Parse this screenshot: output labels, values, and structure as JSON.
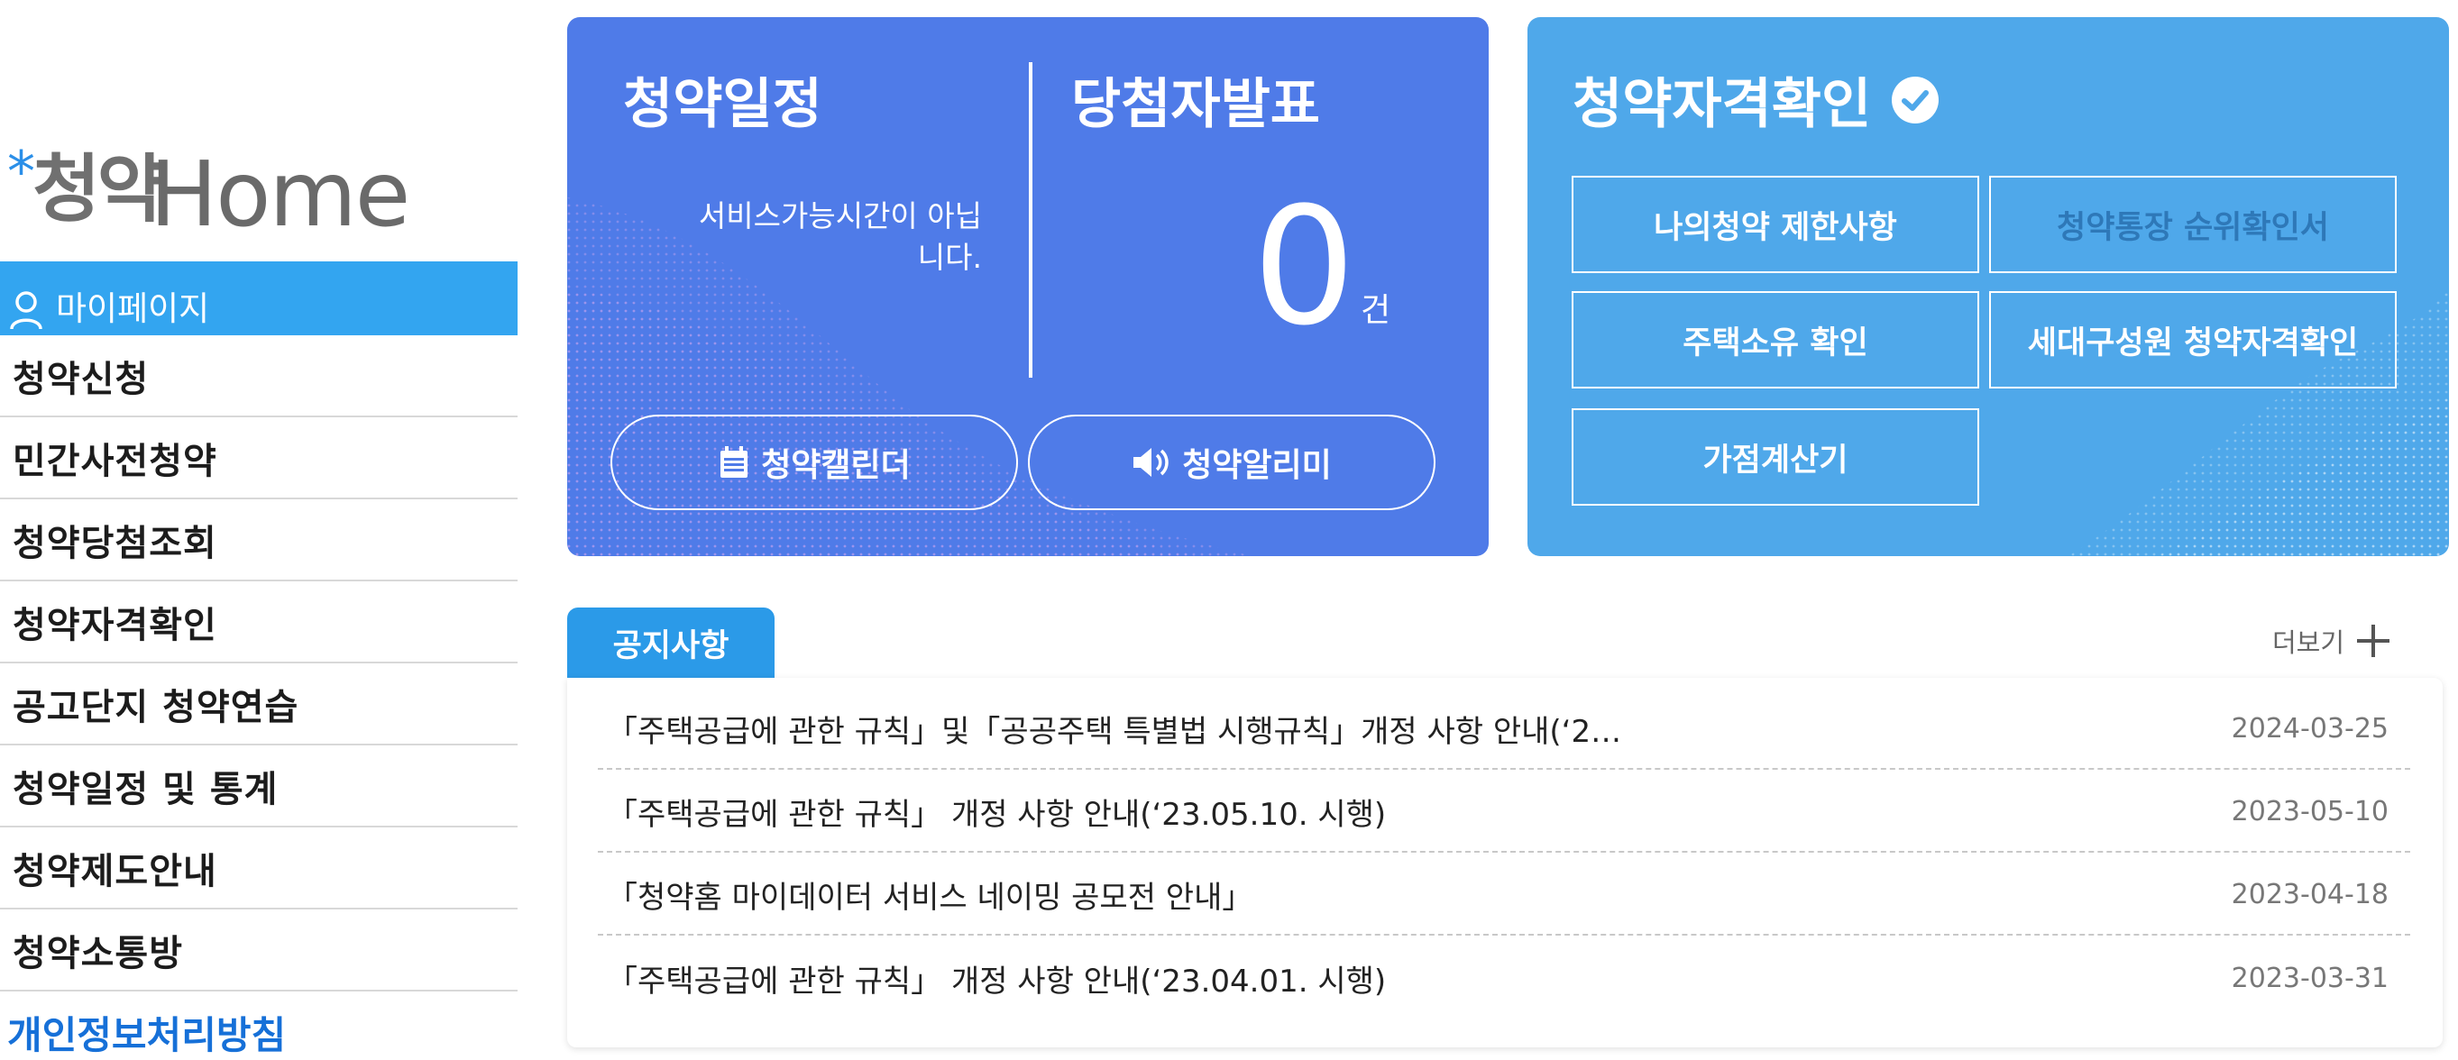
{
  "logo": {
    "star": "*",
    "korean": "청약",
    "english": "Home"
  },
  "sidebar": {
    "mypage_label": "마이페이지",
    "menu": [
      "청약신청",
      "민간사전청약",
      "청약당첨조회",
      "청약자격확인",
      "공고단지 청약연습",
      "청약일정 및 통계",
      "청약제도안내",
      "청약소통방"
    ],
    "privacy_label": "개인정보처리방침"
  },
  "schedule_card": {
    "title": "청약일정",
    "message": "서비스가능시간이 아닙니다.",
    "calendar_button": "청약캘린더",
    "winner_title": "당첨자발표",
    "winner_count": "0",
    "winner_unit": "건",
    "alert_button": "청약알리미"
  },
  "qualification_card": {
    "title": "청약자격확인",
    "buttons": [
      "나의청약 제한사항",
      "청약통장 순위확인서",
      "주택소유 확인",
      "세대구성원 청약자격확인",
      "가점계산기"
    ]
  },
  "notices": {
    "tab_label": "공지사항",
    "more_label": "더보기",
    "items": [
      {
        "title": "「주택공급에 관한 규칙」및「공공주택 특별법 시행규칙」개정 사항 안내(‘2…",
        "date": "2024-03-25"
      },
      {
        "title": "「주택공급에 관한 규칙」 개정 사항 안내(‘23.05.10. 시행)",
        "date": "2023-05-10"
      },
      {
        "title": "「청약홈 마이데이터 서비스 네이밍 공모전 안내」",
        "date": "2023-04-18"
      },
      {
        "title": "「주택공급에 관한 규칙」 개정 사항 안내(‘23.04.01. 시행)",
        "date": "2023-03-31"
      }
    ]
  },
  "colors": {
    "sidebar_active": "#33a5f0",
    "schedule_card_bg": "#4f7be8",
    "qualification_card_bg": "#4fa8ea",
    "notice_tab": "#2b9ae8",
    "privacy_link": "#1670d8"
  }
}
